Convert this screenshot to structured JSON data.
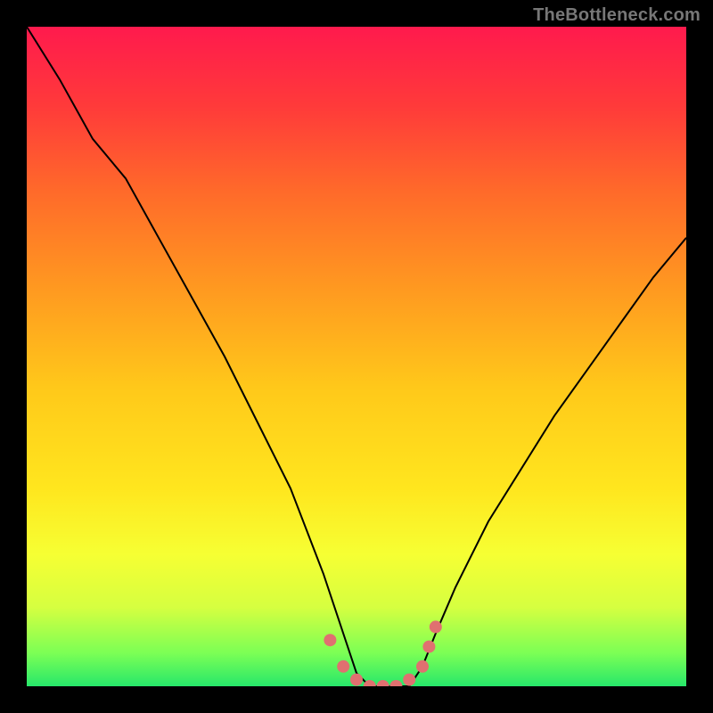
{
  "watermark": {
    "text": "TheBottleneck.com"
  },
  "chart_data": {
    "type": "line",
    "title": "",
    "xlabel": "",
    "ylabel": "",
    "xlim": [
      0,
      100
    ],
    "ylim": [
      0,
      100
    ],
    "grid": false,
    "legend": false,
    "series": [
      {
        "name": "bottleneck-curve",
        "stroke": "#000000",
        "stroke_width": 2,
        "x": [
          0,
          5,
          10,
          15,
          20,
          25,
          30,
          35,
          40,
          45,
          48,
          50,
          52,
          55,
          58,
          60,
          62,
          65,
          70,
          75,
          80,
          85,
          90,
          95,
          100
        ],
        "y": [
          100,
          92,
          83,
          77,
          68,
          59,
          50,
          40,
          30,
          17,
          8,
          2,
          0,
          0,
          0,
          3,
          8,
          15,
          25,
          33,
          41,
          48,
          55,
          62,
          68
        ]
      },
      {
        "name": "highlight-dots",
        "type": "scatter",
        "color": "#e07070",
        "marker_radius": 7,
        "x": [
          46,
          48,
          50,
          52,
          54,
          56,
          58,
          60,
          61,
          62
        ],
        "y": [
          7,
          3,
          1,
          0,
          0,
          0,
          1,
          3,
          6,
          9
        ]
      }
    ]
  }
}
